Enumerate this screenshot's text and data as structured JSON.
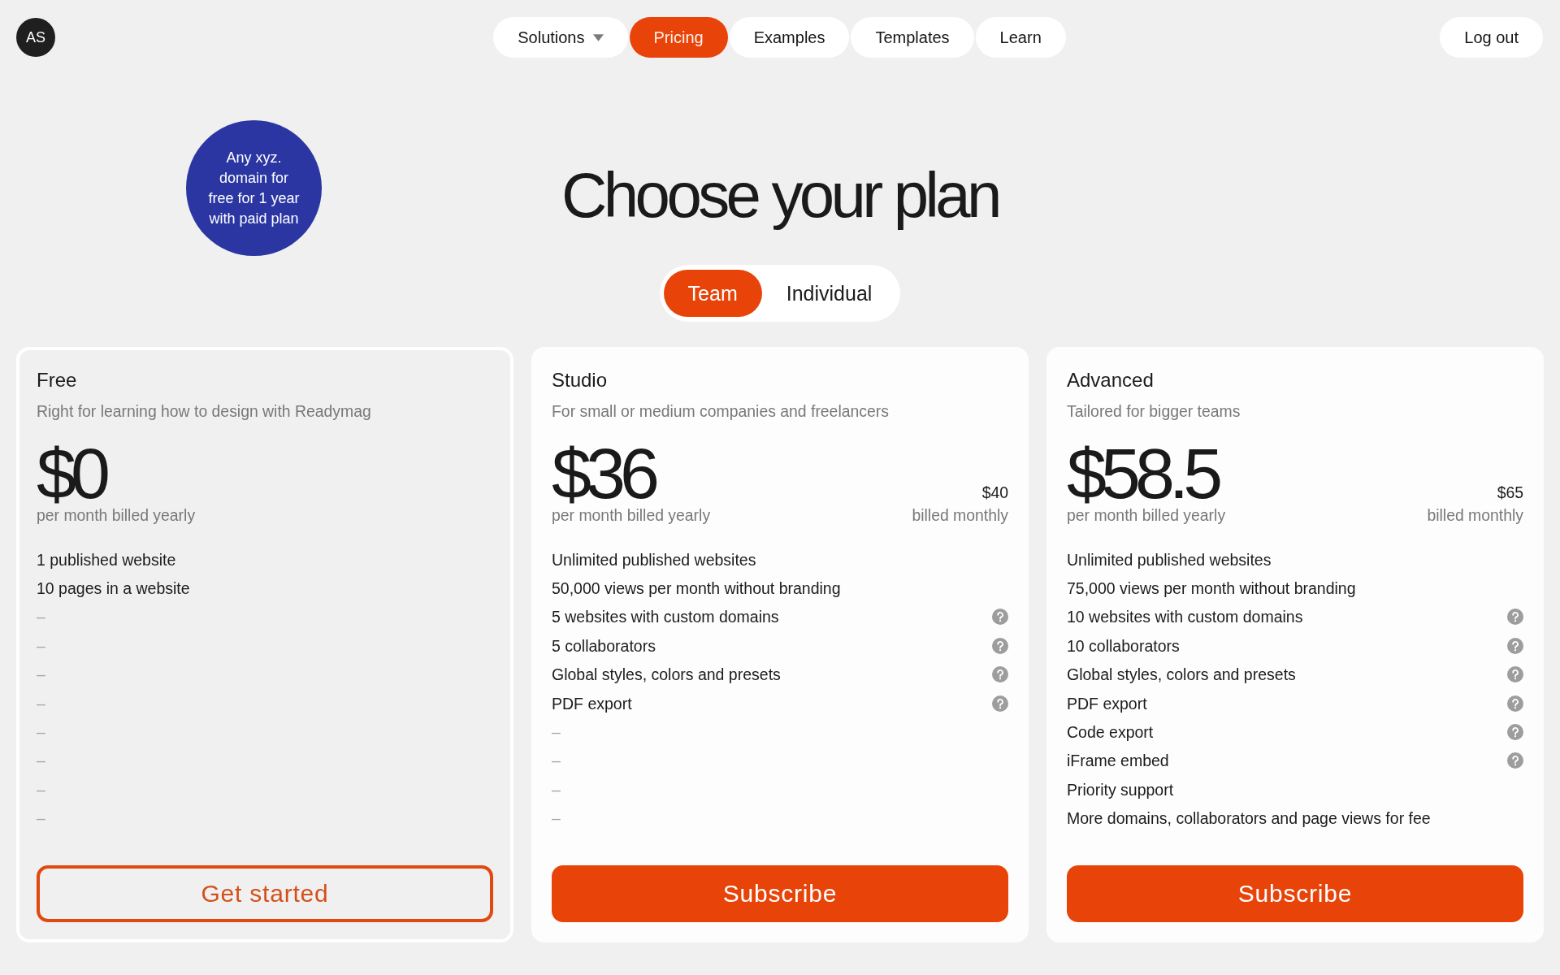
{
  "header": {
    "avatar": {
      "initials": "AS"
    },
    "nav": [
      {
        "label": "Solutions",
        "selected": false,
        "has_menu": true
      },
      {
        "label": "Pricing",
        "selected": true,
        "has_menu": false
      },
      {
        "label": "Examples",
        "selected": false,
        "has_menu": false
      },
      {
        "label": "Templates",
        "selected": false,
        "has_menu": false
      },
      {
        "label": "Learn",
        "selected": false,
        "has_menu": false
      }
    ],
    "logout": {
      "label": "Log out"
    }
  },
  "promo_badge": {
    "text": "Any xyz. domain for free for 1 year with paid plan"
  },
  "title": "Choose your plan",
  "audience_toggle": [
    {
      "label": "Team",
      "selected": true
    },
    {
      "label": "Individual",
      "selected": false
    }
  ],
  "plans": [
    {
      "name": "Free",
      "current": true,
      "description": "Right for learning how to design with Readymag",
      "price": "$0",
      "price_note": "per month billed yearly",
      "features": [
        {
          "text": "1 published website",
          "kind": "included",
          "help": false
        },
        {
          "text": "10 pages in a website",
          "kind": "included",
          "help": false
        },
        {
          "text": "–",
          "kind": "missing",
          "help": false
        },
        {
          "text": "–",
          "kind": "missing",
          "help": false
        },
        {
          "text": "–",
          "kind": "missing",
          "help": false
        },
        {
          "text": "–",
          "kind": "missing",
          "help": false
        },
        {
          "text": "–",
          "kind": "missing",
          "help": false
        },
        {
          "text": "–",
          "kind": "missing",
          "help": false
        },
        {
          "text": "–",
          "kind": "missing",
          "help": false
        },
        {
          "text": "–",
          "kind": "missing",
          "help": false
        }
      ],
      "button": {
        "label": "Get started",
        "kind": "outline"
      }
    },
    {
      "name": "Studio",
      "current": false,
      "description": "For small or medium companies and freelancers",
      "price": "$36",
      "price_note": "per month billed yearly",
      "monthly_price": "$40",
      "monthly_note": "billed monthly",
      "features": [
        {
          "text": "Unlimited published websites",
          "kind": "included",
          "help": false
        },
        {
          "text": "50,000 views per month without branding",
          "kind": "included",
          "help": false
        },
        {
          "text": "5 websites with custom domains",
          "kind": "included",
          "help": true
        },
        {
          "text": "5 collaborators",
          "kind": "included",
          "help": true
        },
        {
          "text": "Global styles, colors and presets",
          "kind": "included",
          "help": true
        },
        {
          "text": "PDF export",
          "kind": "included",
          "help": true
        },
        {
          "text": "–",
          "kind": "missing",
          "help": false
        },
        {
          "text": "–",
          "kind": "missing",
          "help": false
        },
        {
          "text": "–",
          "kind": "missing",
          "help": false
        },
        {
          "text": "–",
          "kind": "missing",
          "help": false
        }
      ],
      "button": {
        "label": "Subscribe",
        "kind": "filled"
      }
    },
    {
      "name": "Advanced",
      "current": false,
      "description": "Tailored for bigger teams",
      "price": "$58.5",
      "price_note": "per month billed yearly",
      "monthly_price": "$65",
      "monthly_note": "billed monthly",
      "features": [
        {
          "text": "Unlimited published websites",
          "kind": "included",
          "help": false
        },
        {
          "text": "75,000 views per month without branding",
          "kind": "included",
          "help": false
        },
        {
          "text": "10 websites with custom domains",
          "kind": "included",
          "help": true
        },
        {
          "text": "10 collaborators",
          "kind": "included",
          "help": true
        },
        {
          "text": "Global styles, colors and presets",
          "kind": "included",
          "help": true
        },
        {
          "text": "PDF export",
          "kind": "included",
          "help": true
        },
        {
          "text": "Code export",
          "kind": "included",
          "help": true
        },
        {
          "text": "iFrame embed",
          "kind": "included",
          "help": true
        },
        {
          "text": "Priority support",
          "kind": "included",
          "help": false
        },
        {
          "text": "More domains, collaborators and page views for fee",
          "kind": "included",
          "help": false
        }
      ],
      "button": {
        "label": "Subscribe",
        "kind": "filled"
      }
    }
  ]
}
